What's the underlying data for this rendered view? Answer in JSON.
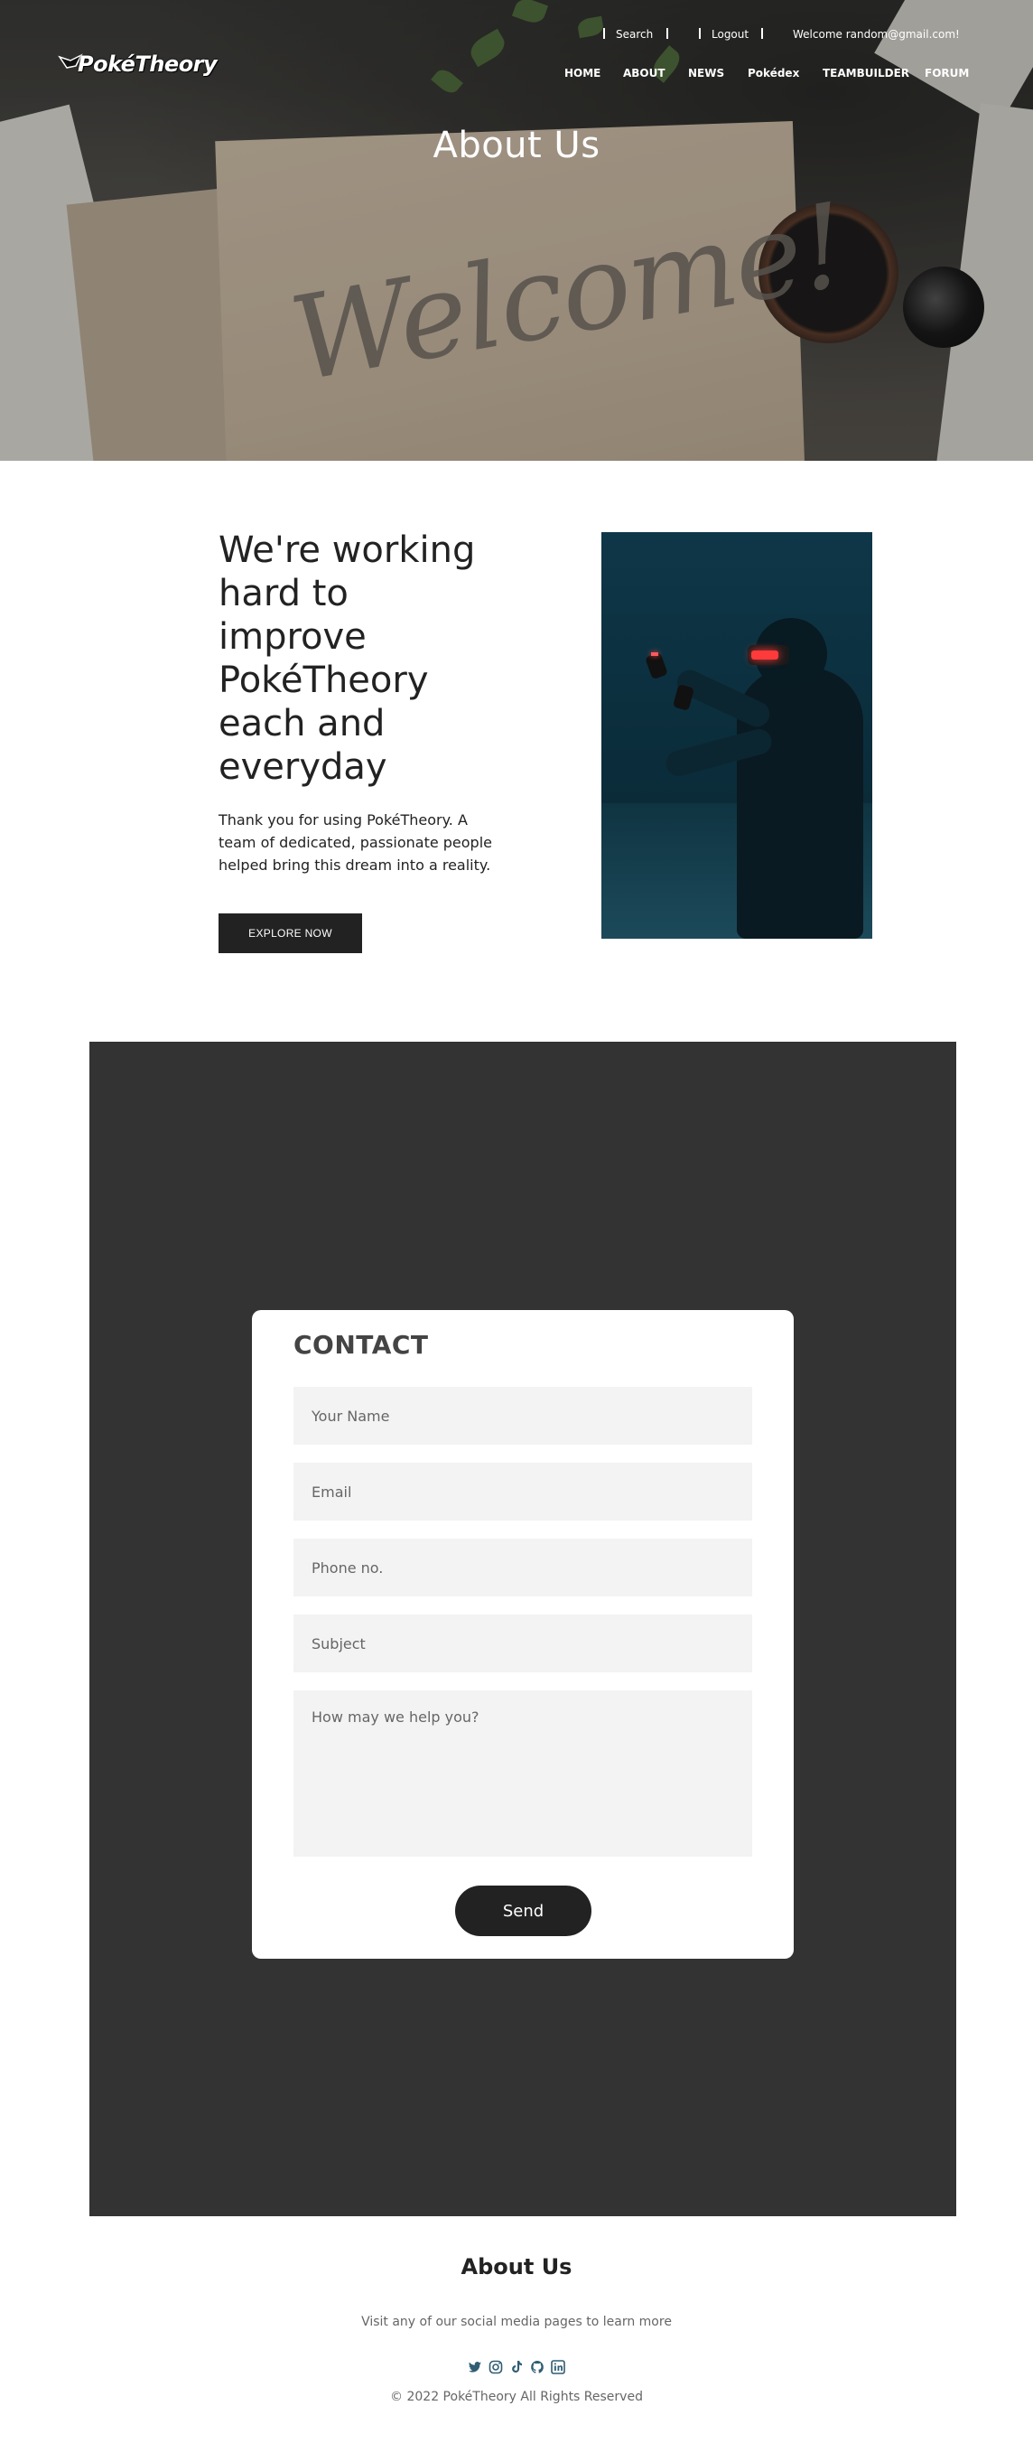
{
  "brand": {
    "name": "PokéTheory",
    "logo_text": "PokéTheory"
  },
  "topbar": {
    "search": "Search",
    "logout": "Logout",
    "welcome": "Welcome random@gmail.com!"
  },
  "nav": {
    "items": [
      "HOME",
      "ABOUT",
      "NEWS",
      "Pokédex",
      "TEAMBUILDER",
      "FORUM"
    ]
  },
  "hero": {
    "title": "About Us",
    "background_script": "Welcome!"
  },
  "intro": {
    "heading_lines": [
      "We're working",
      "hard to",
      "improve",
      "PokéTheory",
      "each and",
      "everyday"
    ],
    "text_lines": [
      "Thank you for using PokéTheory. A",
      "team of dedicated, passionate people",
      "helped bring this dream into a reality."
    ],
    "button": "EXPLORE NOW"
  },
  "contact": {
    "title": "CONTACT",
    "fields": {
      "name": "Your Name",
      "email": "Email",
      "phone": "Phone no.",
      "subject": "Subject",
      "message": "How may we help you?"
    },
    "send": "Send"
  },
  "footer": {
    "title": "About Us",
    "text": "Visit any of our social media pages to learn more",
    "social_icons": [
      "twitter-icon",
      "instagram-icon",
      "tiktok-icon",
      "github-icon",
      "linkedin-icon"
    ],
    "copyright": "© 2022 PokéTheory All Rights Reserved"
  },
  "colors": {
    "dark": "#222222",
    "contact_bg": "#333333",
    "field_bg": "#f3f3f3",
    "social": "#2f5d73"
  }
}
